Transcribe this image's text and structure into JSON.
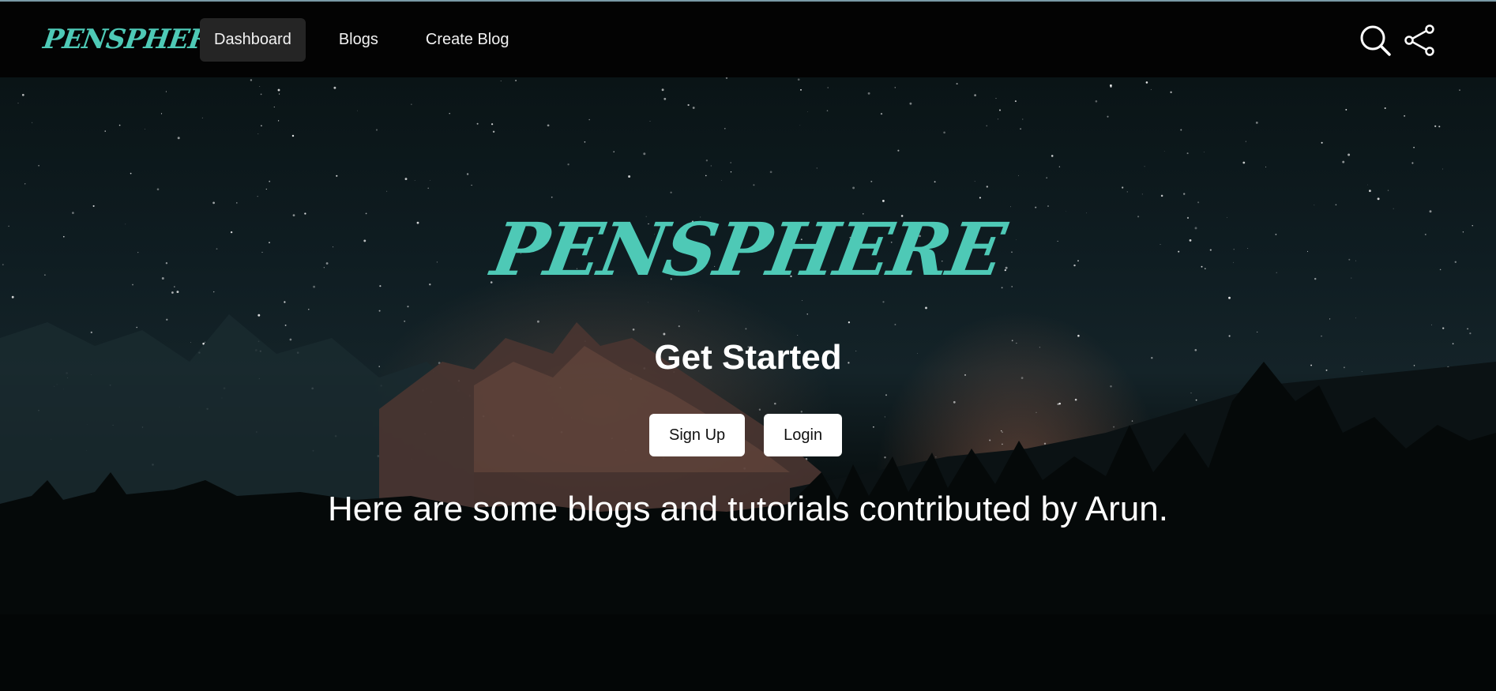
{
  "brand": {
    "name": "PENSPHERE",
    "color": "#4ec9b6"
  },
  "nav": {
    "links": [
      {
        "label": "Dashboard",
        "active": true
      },
      {
        "label": "Blogs",
        "active": false
      },
      {
        "label": "Create Blog",
        "active": false
      }
    ],
    "icons": [
      "search-icon",
      "share-icon"
    ]
  },
  "hero": {
    "logo": "PENSPHERE",
    "title": "Get Started",
    "buttons": {
      "signup": "Sign Up",
      "login": "Login"
    },
    "text": "Here are some blogs and tutorials contributed by Arun."
  },
  "colors": {
    "accent": "#4ec9b6",
    "navbar_bg": "#030303",
    "active_tab_bg": "#252525"
  }
}
